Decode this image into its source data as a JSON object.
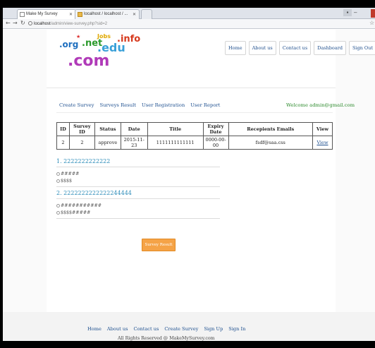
{
  "browser": {
    "tabs": [
      {
        "label": "Make My Survey"
      },
      {
        "label": "localhost / localhost / ..."
      }
    ],
    "url_host": "localhost",
    "url_path": "/admin/view-survey.php?sid=2"
  },
  "logo": {
    "org": ".org",
    "net": ".net",
    "jobs": "Jobs",
    "edu": ".edu",
    "info": ".info",
    "com": ".com"
  },
  "top_nav": [
    "Home",
    "About us",
    "Contact us",
    "Dashboard",
    "Sign Out"
  ],
  "menu": [
    "Create Survey",
    "Surveys Result",
    "User Registration",
    "User Report"
  ],
  "welcome": "Welcome admin@gmail.com",
  "table": {
    "headers": [
      "ID",
      "Survey ID",
      "Status",
      "Date",
      "Title",
      "Expiry Date",
      "Recepients Emails",
      "View"
    ],
    "rows": [
      [
        "2",
        "2",
        "approve",
        "2015-11-23",
        "1111111111111",
        "0000-00-00",
        "fsdf@saa.css",
        "View"
      ]
    ]
  },
  "questions": [
    {
      "text": "1. 2222222222222",
      "options": [
        "#####",
        "$$$$"
      ]
    },
    {
      "text": "2. 2222222222222244444",
      "options": [
        "###########",
        "$$$$#####"
      ]
    }
  ],
  "submit_label": "Survey Result",
  "footer": {
    "links": [
      "Home",
      "About us",
      "Contact us",
      "Create Survey",
      "Sign Up",
      "Sign In"
    ],
    "copyright": "All Rights Reserved @ MakeMySurvey.com"
  },
  "colors": {
    "link": "#1d4f8f",
    "welcome": "#2c8a2c",
    "question": "#2b8bb8",
    "submit": "#f5a347"
  }
}
